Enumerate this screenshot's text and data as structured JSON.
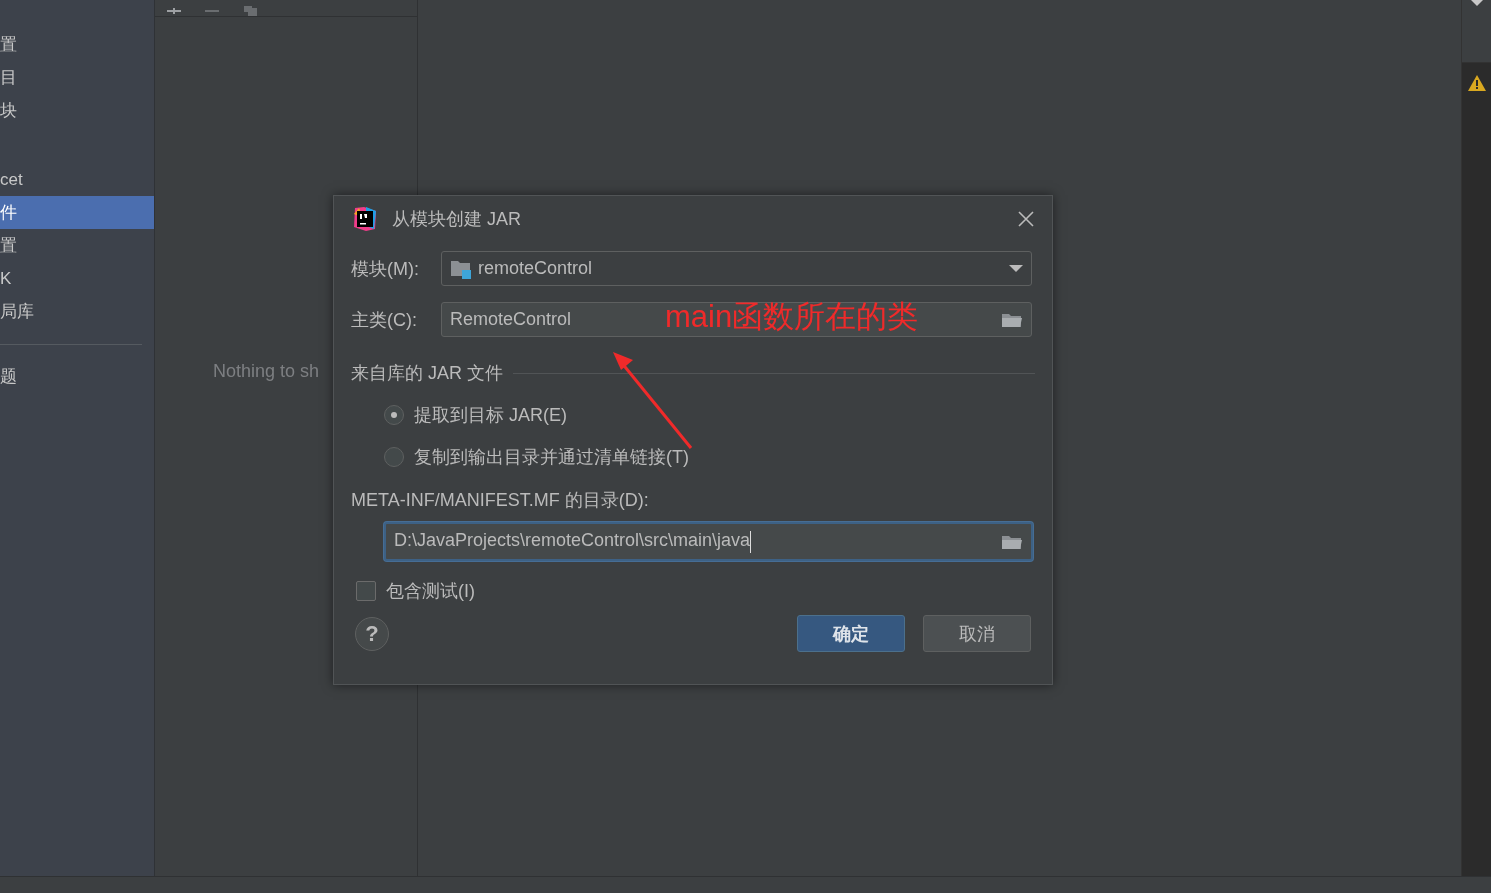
{
  "sidebar": {
    "sections": [
      {
        "items": [
          {
            "label": "置",
            "selected": false
          },
          {
            "label": "目",
            "selected": false
          },
          {
            "label": "块",
            "selected": false
          }
        ]
      },
      {
        "divider": false,
        "items": [
          {
            "label": "cet",
            "selected": false
          },
          {
            "label": "件",
            "selected": true
          },
          {
            "label": "置",
            "selected": false
          },
          {
            "label": "K",
            "selected": false
          },
          {
            "label": "局库",
            "selected": false
          }
        ]
      },
      {
        "divider": true,
        "items": [
          {
            "label": "题",
            "selected": false
          }
        ]
      }
    ]
  },
  "list_panel": {
    "empty_text": "Nothing to sh"
  },
  "dialog": {
    "title": "从模块创建 JAR",
    "module_field": {
      "label": "模块(M):",
      "value": "remoteControl"
    },
    "main_class_field": {
      "label": "主类(C):",
      "value": "RemoteControl"
    },
    "annotation": {
      "text": "main函数所在的类"
    },
    "library_group": {
      "title": "来自库的 JAR 文件",
      "options": [
        {
          "label": "提取到目标 JAR(E)",
          "selected": true
        },
        {
          "label": "复制到输出目录并通过清单链接(T)",
          "selected": false
        }
      ]
    },
    "manifest_field": {
      "label": "META-INF/MANIFEST.MF 的目录(D):",
      "value": "D:\\JavaProjects\\remoteControl\\src\\main\\java",
      "focused": true
    },
    "include_tests": {
      "label": "包含测试(I)",
      "checked": false
    },
    "help_button": {
      "label": "?"
    },
    "buttons": [
      {
        "label": "确定",
        "kind": "primary"
      },
      {
        "label": "取消",
        "kind": "secondary"
      }
    ]
  }
}
